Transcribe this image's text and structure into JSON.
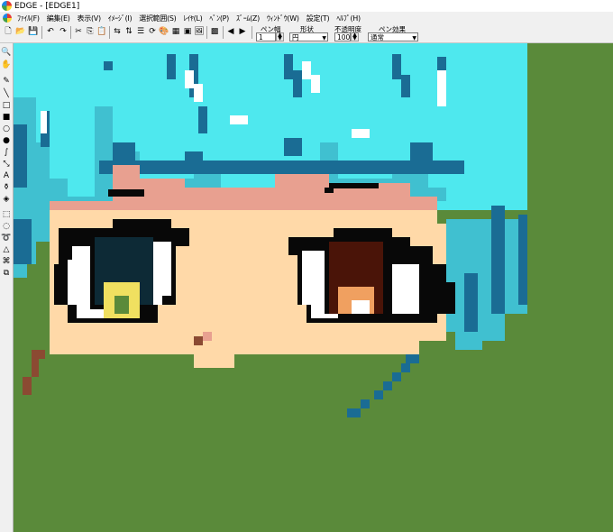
{
  "window": {
    "title": "EDGE - [EDGE1]"
  },
  "menu": {
    "items": [
      "ﾌｧｲﾙ(F)",
      "編集(E)",
      "表示(V)",
      "ｲﾒｰｼﾞ(I)",
      "選択範囲(S)",
      "ﾚｲﾔ(L)",
      "ﾍﾟﾝ(P)",
      "ｽﾞｰﾑ(Z)",
      "ｳｨﾝﾄﾞｳ(W)",
      "設定(T)",
      "ﾍﾙﾌﾟ(H)"
    ]
  },
  "toolbar": {
    "pen_width": {
      "label": "ペン幅",
      "value": "1"
    },
    "shape": {
      "label": "形状",
      "value": "円"
    },
    "opacity": {
      "label": "不透明度",
      "value": "100"
    },
    "pen_effect": {
      "label": "ペン効果",
      "value": "通常"
    },
    "buttons": [
      "new-icon",
      "open-icon",
      "save-icon",
      "undo-icon",
      "redo-icon",
      "cut-icon",
      "copy-icon",
      "paste-icon",
      "flip-horizontal-icon",
      "flip-vertical-icon",
      "layer-icon",
      "rotate-icon",
      "palette-icon",
      "grid-icon",
      "preview-icon",
      "image-icon",
      "pattern-icon",
      "prev-frame-icon",
      "next-frame-icon"
    ]
  },
  "tools": [
    "zoom-icon",
    "hand-icon",
    "pen-icon",
    "line-icon",
    "rectangle-icon",
    "filled-rectangle-icon",
    "ellipse-icon",
    "filled-ellipse-icon",
    "curve-icon",
    "dropper-icon",
    "text-icon",
    "spray-icon",
    "fill-icon",
    "rect-select-icon",
    "ellipse-select-icon",
    "lasso-icon",
    "polygon-select-icon",
    "magic-wand-icon",
    "move-icon"
  ],
  "colors": {
    "background_green": "#5a8a3a",
    "hair_cyan": "#4ee8ee",
    "hair_mid": "#40c0d0",
    "hair_dark": "#1a6c94",
    "skin": "#ffd9a8",
    "skin_shadow": "#e8a090",
    "eye_black": "#080808",
    "white": "#ffffff",
    "left_iris": "#0d2a36",
    "left_iris_accent": "#f0e060",
    "left_iris_green": "#5a8a3a",
    "right_iris": "#4a1408",
    "right_iris_accent": "#f0a060",
    "brown_accent": "#8b4a32"
  }
}
